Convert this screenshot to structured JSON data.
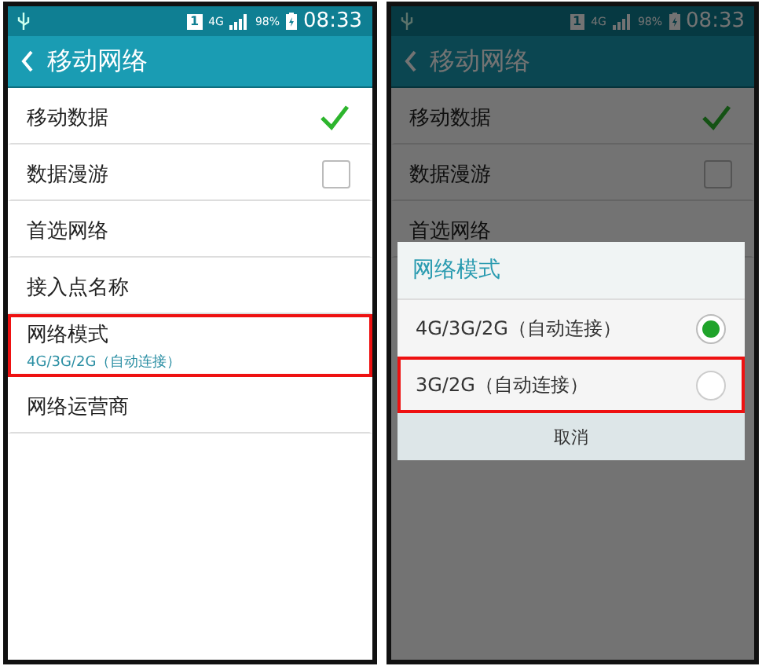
{
  "screens": [
    {
      "dimmed": false,
      "status_bar": {
        "sim": "1",
        "network": "4G",
        "battery": "98%",
        "time": "08:33"
      },
      "title": "移动网络",
      "items": [
        {
          "kind": "checkbox",
          "label": "移动数据",
          "checked": true,
          "highlighted": false
        },
        {
          "kind": "checkbox",
          "label": "数据漫游",
          "checked": false,
          "highlighted": false
        },
        {
          "kind": "plain",
          "label": "首选网络",
          "highlighted": false
        },
        {
          "kind": "plain",
          "label": "接入点名称",
          "highlighted": false
        },
        {
          "kind": "plain",
          "label": "网络模式",
          "summary": "4G/3G/2G（自动连接）",
          "highlighted": true
        },
        {
          "kind": "plain",
          "label": "网络运营商",
          "highlighted": false
        }
      ]
    },
    {
      "dimmed": true,
      "status_bar": {
        "sim": "1",
        "network": "4G",
        "battery": "98%",
        "time": "08:33"
      },
      "title": "移动网络",
      "items": [
        {
          "kind": "checkbox",
          "label": "移动数据",
          "checked": true,
          "highlighted": false
        },
        {
          "kind": "checkbox",
          "label": "数据漫游",
          "checked": false,
          "highlighted": false
        },
        {
          "kind": "plain",
          "label": "首选网络",
          "highlighted": false
        }
      ],
      "dialog": {
        "title": "网络模式",
        "options": [
          {
            "label": "4G/3G/2G（自动连接）",
            "selected": true,
            "highlighted": false
          },
          {
            "label": "3G/2G（自动连接）",
            "selected": false,
            "highlighted": true
          }
        ],
        "cancel": "取消"
      }
    }
  ]
}
